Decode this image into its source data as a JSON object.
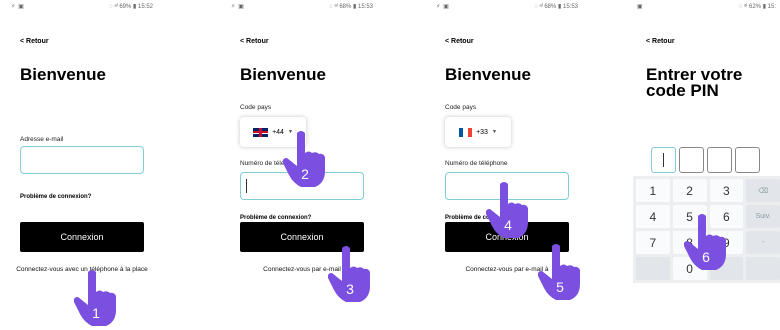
{
  "colors": {
    "accent_border": "#7ecfd8",
    "hand_purple": "#7b4fe0",
    "button_black": "#000000"
  },
  "screens": [
    {
      "status_right": "◌ ᵃˡ 69% ▮ 15:52",
      "back": "< Retour",
      "title": "Bienvenue",
      "email_label": "Adresse e-mail",
      "problem": "Problème de connexion?",
      "button": "Connexion",
      "alt_link": "Connectez-vous avec un téléphone à la place",
      "step": "1"
    },
    {
      "status_right": "◌ ᵃˡ 68% ▮ 15:53",
      "back": "< Retour",
      "title": "Bienvenue",
      "code_label": "Code pays",
      "country_code": "+44",
      "phone_label": "Numéro de télé",
      "problem": "Problème de connexion?",
      "button": "Connexion",
      "alt_link": "Connectez-vous par e-mail",
      "steps": [
        "2",
        "3"
      ]
    },
    {
      "status_right": "◌ ᵃˡ 68% ▮ 15:53",
      "back": "< Retour",
      "title": "Bienvenue",
      "code_label": "Code pays",
      "country_code": "+33",
      "phone_label": "Numéro de téléphone",
      "problem": "Problème de co",
      "button": "Connexion",
      "alt_link": "Connectez-vous par e-mail à",
      "steps": [
        "4",
        "5"
      ]
    },
    {
      "status_right": "◌ ᵃˡ 62% ▮ 15:",
      "back": "< Retour",
      "title_line1": "Entrer votre",
      "title_line2": "code PIN",
      "keys": [
        "1",
        "2",
        "3",
        "⌫",
        "4",
        "5",
        "6",
        "Suiv.",
        "7",
        "8",
        "9",
        "-",
        "",
        "0",
        "",
        ""
      ],
      "step": "6"
    }
  ]
}
